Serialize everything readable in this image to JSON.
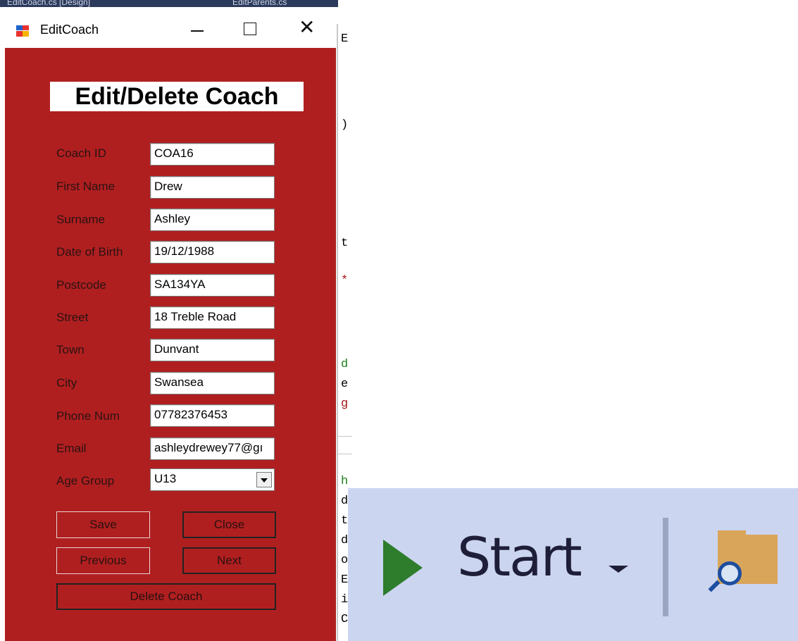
{
  "background_ide": {
    "tab1": "EditCoach.cs [Design]",
    "tab2": "EditParents.cs",
    "code_fragments": [
      "E",
      ")",
      "t",
      "*",
      "d",
      "e",
      "g",
      "h",
      "d",
      "t",
      "d",
      "o",
      "E",
      "i",
      "C"
    ]
  },
  "window": {
    "title": "EditCoach",
    "heading": "Edit/Delete Coach"
  },
  "form": {
    "fields": [
      {
        "label": "Coach ID",
        "value": "COA16"
      },
      {
        "label": "First Name",
        "value": "Drew"
      },
      {
        "label": "Surname",
        "value": "Ashley"
      },
      {
        "label": "Date of Birth",
        "value": "19/12/1988"
      },
      {
        "label": "Postcode",
        "value": "SA134YA"
      },
      {
        "label": "Street",
        "value": "18 Treble Road"
      },
      {
        "label": "Town",
        "value": "Dunvant"
      },
      {
        "label": "City",
        "value": "Swansea"
      },
      {
        "label": "Phone Num",
        "value": "07782376453"
      },
      {
        "label": "Email",
        "value": "ashleydrewey77@gı"
      }
    ],
    "age_group": {
      "label": "Age Group",
      "value": "U13"
    }
  },
  "buttons": {
    "save": "Save",
    "close": "Close",
    "previous": "Previous",
    "next": "Next",
    "delete": "Delete Coach"
  },
  "toolbar": {
    "start_label": "Start",
    "icons": [
      "play-icon",
      "dropdown-arrow-icon",
      "folder-search-icon"
    ],
    "colors": {
      "background": "#ccd5f0",
      "play": "#2d7d2d",
      "folder": "#d9a55a"
    }
  },
  "colors": {
    "form_background": "#b01f20"
  }
}
